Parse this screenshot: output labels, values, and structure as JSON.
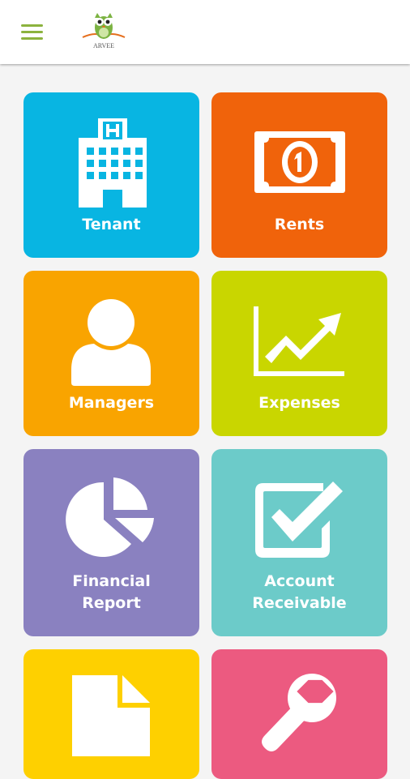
{
  "header": {
    "menu_icon": "hamburger-menu-icon",
    "logo_icon": "arvee-owl-logo",
    "logo_text": "ARVEE",
    "accent_color": "#8cb33e"
  },
  "tiles": [
    {
      "label": "Tenant",
      "icon": "hotel-building-icon",
      "color": "#08b5e2"
    },
    {
      "label": "Rents",
      "icon": "banknote-icon",
      "color": "#f0630b"
    },
    {
      "label": "Managers",
      "icon": "person-icon",
      "color": "#f9a400"
    },
    {
      "label": "Expenses",
      "icon": "trending-chart-icon",
      "color": "#c9d600"
    },
    {
      "label_line1": "Financial",
      "label_line2": "Report",
      "icon": "pie-chart-icon",
      "color": "#8a81c0"
    },
    {
      "label_line1": "Account",
      "label_line2": "Receivable",
      "icon": "checkbox-icon",
      "color": "#6ccbc9"
    },
    {
      "label": "",
      "icon": "document-icon",
      "color": "#fed000"
    },
    {
      "label": "",
      "icon": "wrench-icon",
      "color": "#ec5a80"
    }
  ]
}
